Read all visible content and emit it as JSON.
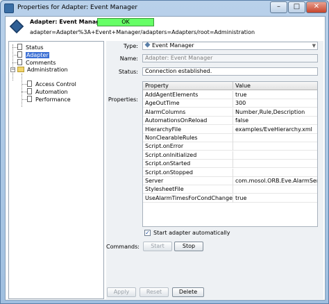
{
  "window": {
    "title": "Properties for Adapter: Event Manager",
    "minimize_glyph": "–",
    "maximize_glyph": "□",
    "close_glyph": "✕"
  },
  "header": {
    "title": "Adapter: Event Manager",
    "status_badge": "OK",
    "path": "adapter=Adapter%3A+Event+Manager/adapters=Adapters/root=Administration",
    "badge_color": "#66ff66"
  },
  "tree": {
    "items": [
      {
        "label": "Status",
        "icon": "document-icon"
      },
      {
        "label": "Adapter",
        "icon": "document-icon",
        "selected": true
      },
      {
        "label": "Comments",
        "icon": "document-icon"
      },
      {
        "label": "Administration",
        "icon": "folder-icon",
        "expander": "−"
      },
      {
        "label": "Access Control",
        "icon": "document-icon"
      },
      {
        "label": "Automation",
        "icon": "document-icon"
      },
      {
        "label": "Performance",
        "icon": "document-icon"
      }
    ]
  },
  "form": {
    "type_label": "Type:",
    "type_value": "Event Manager",
    "type_arrow": "▼",
    "name_label": "Name:",
    "name_value": "Adapter: Event Manager",
    "status_label": "Status:",
    "status_value": "Connection established.",
    "properties_label": "Properties:",
    "commands_label": "Commands:"
  },
  "table": {
    "columns": [
      "Property",
      "Value"
    ],
    "rows": [
      [
        "AddAgentElements",
        "true"
      ],
      [
        "AgeOutTime",
        "300"
      ],
      [
        "AlarmColumns",
        "Number,Rule,Description"
      ],
      [
        "AutomationsOnReload",
        "false"
      ],
      [
        "HierarchyFile",
        "examples/EveHierarchy.xml"
      ],
      [
        "NonClearableRules",
        ""
      ],
      [
        "Script.onError",
        ""
      ],
      [
        "Script.onInitialized",
        ""
      ],
      [
        "Script.onStarted",
        ""
      ],
      [
        "Script.onStopped",
        ""
      ],
      [
        "Server",
        "com.mosol.ORB.Eve.AlarmServer"
      ],
      [
        "StylesheetFile",
        ""
      ],
      [
        "UseAlarmTimesForCondChanges",
        "true"
      ]
    ]
  },
  "start_auto": {
    "label": "Start adapter automatically",
    "checked": true,
    "check_glyph": "✓"
  },
  "buttons": {
    "start": "Start",
    "stop": "Stop",
    "apply": "Apply",
    "reset": "Reset",
    "delete": "Delete"
  }
}
